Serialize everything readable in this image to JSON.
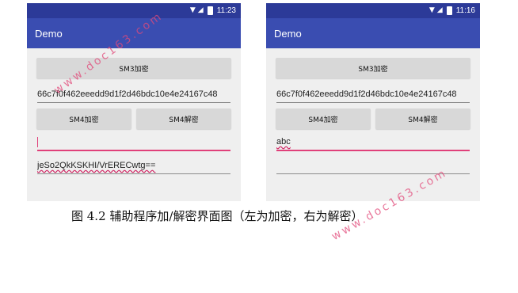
{
  "left": {
    "status_time": "11:23",
    "app_title": "Demo",
    "sm3_label": "SM3加密",
    "hash_value": "66c7f0f462eeedd9d1f2d46bdc10e4e24167c48",
    "sm4_encrypt_label": "SM4加密",
    "sm4_decrypt_label": "SM4解密",
    "input_value": "",
    "output_value": "jeSo2QkKSKHI/VrERECwtg=="
  },
  "right": {
    "status_time": "11:16",
    "app_title": "Demo",
    "sm3_label": "SM3加密",
    "hash_value": "66c7f0f462eeedd9d1f2d46bdc10e4e24167c48",
    "sm4_encrypt_label": "SM4加密",
    "sm4_decrypt_label": "SM4解密",
    "input_value": "abc",
    "output_value": ""
  },
  "watermark": "www.doc163.com",
  "caption": "图 4.2 辅助程序加/解密界面图（左为加密，右为解密）",
  "colors": {
    "status_bar": "#2c3a98",
    "app_bar": "#3a4db1",
    "accent": "#e0407a"
  }
}
